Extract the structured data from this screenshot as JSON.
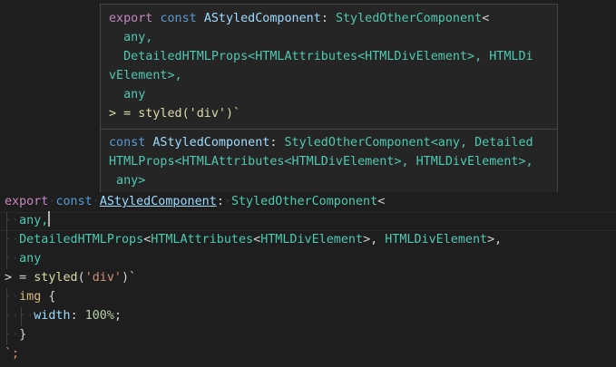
{
  "hover": {
    "signature_lines": [
      {
        "kw1": "export",
        "kw2": "const",
        "name": "AStyledComponent",
        "rest": ": ",
        "type": "StyledOtherComponent",
        "tail": "<"
      },
      {
        "text": "  any,"
      },
      {
        "text": "  DetailedHTMLProps<HTMLAttributes<HTMLDivElement>, HTMLDi"
      },
      {
        "text": "vElement>,"
      },
      {
        "text": "  any"
      },
      {
        "text": "> = styled('div')`"
      }
    ],
    "doc_lines": [
      {
        "kw": "const",
        "name": "AStyledComponent",
        "rest": ": ",
        "type": "StyledOtherComponent",
        "tail": "<any, Detailed"
      },
      {
        "text": "HTMLProps<HTMLAttributes<HTMLDivElement>, HTMLDivElement>,"
      },
      {
        "text": " any>"
      }
    ]
  },
  "editor": {
    "line1": {
      "kw1": "export",
      "kw2": "const",
      "name": "AStyledComponent",
      "colon": ":",
      "type": "StyledOtherComponent",
      "tail": "<"
    },
    "line2": {
      "text": "any,"
    },
    "line3": {
      "a": "DetailedHTMLProps",
      "b": "<",
      "c": "HTMLAttributes",
      "d": "<",
      "e": "HTMLDivElement",
      "f": ">, ",
      "g": "HTMLDivElement",
      "h": ">,"
    },
    "line4": {
      "text": "any"
    },
    "line5": {
      "gt": ">",
      "eq": " = ",
      "fn": "styled",
      "open": "(",
      "str": "'div'",
      "close": ")`"
    },
    "line6": {
      "tag": "img",
      "brace": " {"
    },
    "line7": {
      "prop": "width",
      "colon": ": ",
      "num": "100%",
      "semi": ";"
    },
    "line8": {
      "text": "}"
    },
    "line9": {
      "text": "`;"
    }
  }
}
